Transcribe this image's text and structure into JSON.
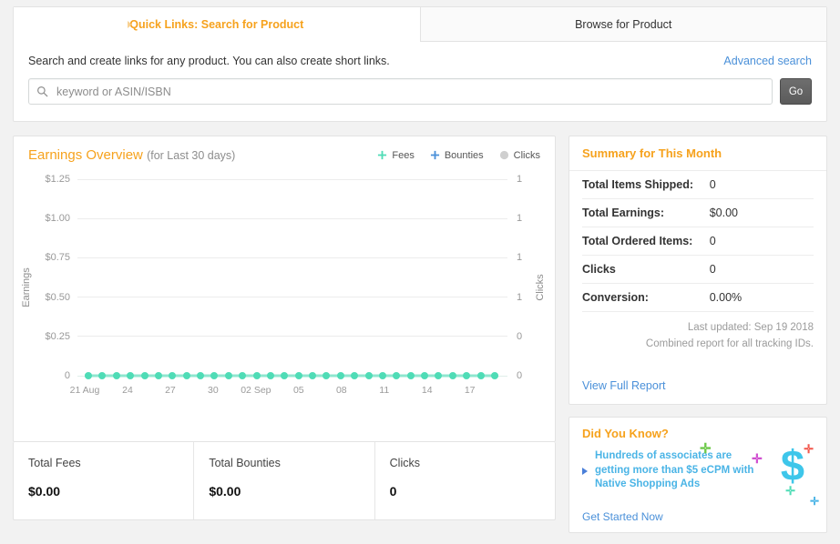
{
  "search_card": {
    "tabs": [
      {
        "label": "Quick Links: Search for Product",
        "active": true
      },
      {
        "label": "Browse for Product",
        "active": false
      }
    ],
    "hint": "Search and create links for any product. You can also create short links.",
    "advanced_link": "Advanced search",
    "input_placeholder": "keyword or ASIN/ISBN",
    "input_value": "",
    "go_label": "Go"
  },
  "chart_panel": {
    "title": "Earnings Overview",
    "subtitle": "(for Last 30 days)",
    "legend": [
      {
        "label": "Fees",
        "color": "#4fdcb6",
        "marker": "plus"
      },
      {
        "label": "Bounties",
        "color": "#4a90d9",
        "marker": "plus"
      },
      {
        "label": "Clicks",
        "color": "#cfcfcf",
        "marker": "circle"
      }
    ]
  },
  "chart_data": {
    "type": "line",
    "title": "Earnings Overview (for Last 30 days)",
    "xlabel": "",
    "ylabel": "Earnings",
    "y2label": "Clicks",
    "ylim": [
      0,
      1.25
    ],
    "y2lim": [
      0,
      1
    ],
    "grid": true,
    "legend_position": "top-right",
    "yticks": [
      "0",
      "$0.25",
      "$0.50",
      "$0.75",
      "$1.00",
      "$1.25"
    ],
    "y2ticks": [
      "0",
      "0",
      "1",
      "1",
      "1",
      "1"
    ],
    "xticks": [
      "21 Aug",
      "24",
      "27",
      "30",
      "02 Sep",
      "05",
      "08",
      "11",
      "14",
      "17"
    ],
    "x": [
      "21 Aug",
      "22 Aug",
      "23 Aug",
      "24 Aug",
      "25 Aug",
      "26 Aug",
      "27 Aug",
      "28 Aug",
      "29 Aug",
      "30 Aug",
      "31 Aug",
      "01 Sep",
      "02 Sep",
      "03 Sep",
      "04 Sep",
      "05 Sep",
      "06 Sep",
      "07 Sep",
      "08 Sep",
      "09 Sep",
      "10 Sep",
      "11 Sep",
      "12 Sep",
      "13 Sep",
      "14 Sep",
      "15 Sep",
      "16 Sep",
      "17 Sep",
      "18 Sep",
      "19 Sep"
    ],
    "series": [
      {
        "name": "Fees",
        "color": "#4fdcb6",
        "values": [
          0,
          0,
          0,
          0,
          0,
          0,
          0,
          0,
          0,
          0,
          0,
          0,
          0,
          0,
          0,
          0,
          0,
          0,
          0,
          0,
          0,
          0,
          0,
          0,
          0,
          0,
          0,
          0,
          0,
          0
        ]
      },
      {
        "name": "Bounties",
        "color": "#4a90d9",
        "values": [
          0,
          0,
          0,
          0,
          0,
          0,
          0,
          0,
          0,
          0,
          0,
          0,
          0,
          0,
          0,
          0,
          0,
          0,
          0,
          0,
          0,
          0,
          0,
          0,
          0,
          0,
          0,
          0,
          0,
          0
        ]
      },
      {
        "name": "Clicks",
        "color": "#cfcfcf",
        "values": [
          0,
          0,
          0,
          0,
          0,
          0,
          0,
          0,
          0,
          0,
          0,
          0,
          0,
          0,
          0,
          0,
          0,
          0,
          0,
          0,
          0,
          0,
          0,
          0,
          0,
          0,
          0,
          0,
          0,
          0
        ]
      }
    ]
  },
  "totals": [
    {
      "label": "Total Fees",
      "value": "$0.00"
    },
    {
      "label": "Total Bounties",
      "value": "$0.00"
    },
    {
      "label": "Clicks",
      "value": "0"
    }
  ],
  "summary": {
    "heading": "Summary for This Month",
    "rows": [
      {
        "key": "Total Items Shipped:",
        "value": "0"
      },
      {
        "key": "Total Earnings:",
        "value": "$0.00"
      },
      {
        "key": "Total Ordered Items:",
        "value": "0"
      },
      {
        "key": "Clicks",
        "value": "0"
      },
      {
        "key": "Conversion:",
        "value": "0.00%"
      }
    ],
    "last_updated": "Last updated: Sep 19 2018",
    "note": "Combined report for all tracking IDs.",
    "report_link": "View Full Report"
  },
  "promo": {
    "heading": "Did You Know?",
    "line1": "Hundreds of associates are",
    "line2": "getting more than $5 eCPM with",
    "line3": "Native Shopping Ads",
    "link": "Get Started Now",
    "dollar": "$",
    "accent_color": "#3ec6ea"
  }
}
